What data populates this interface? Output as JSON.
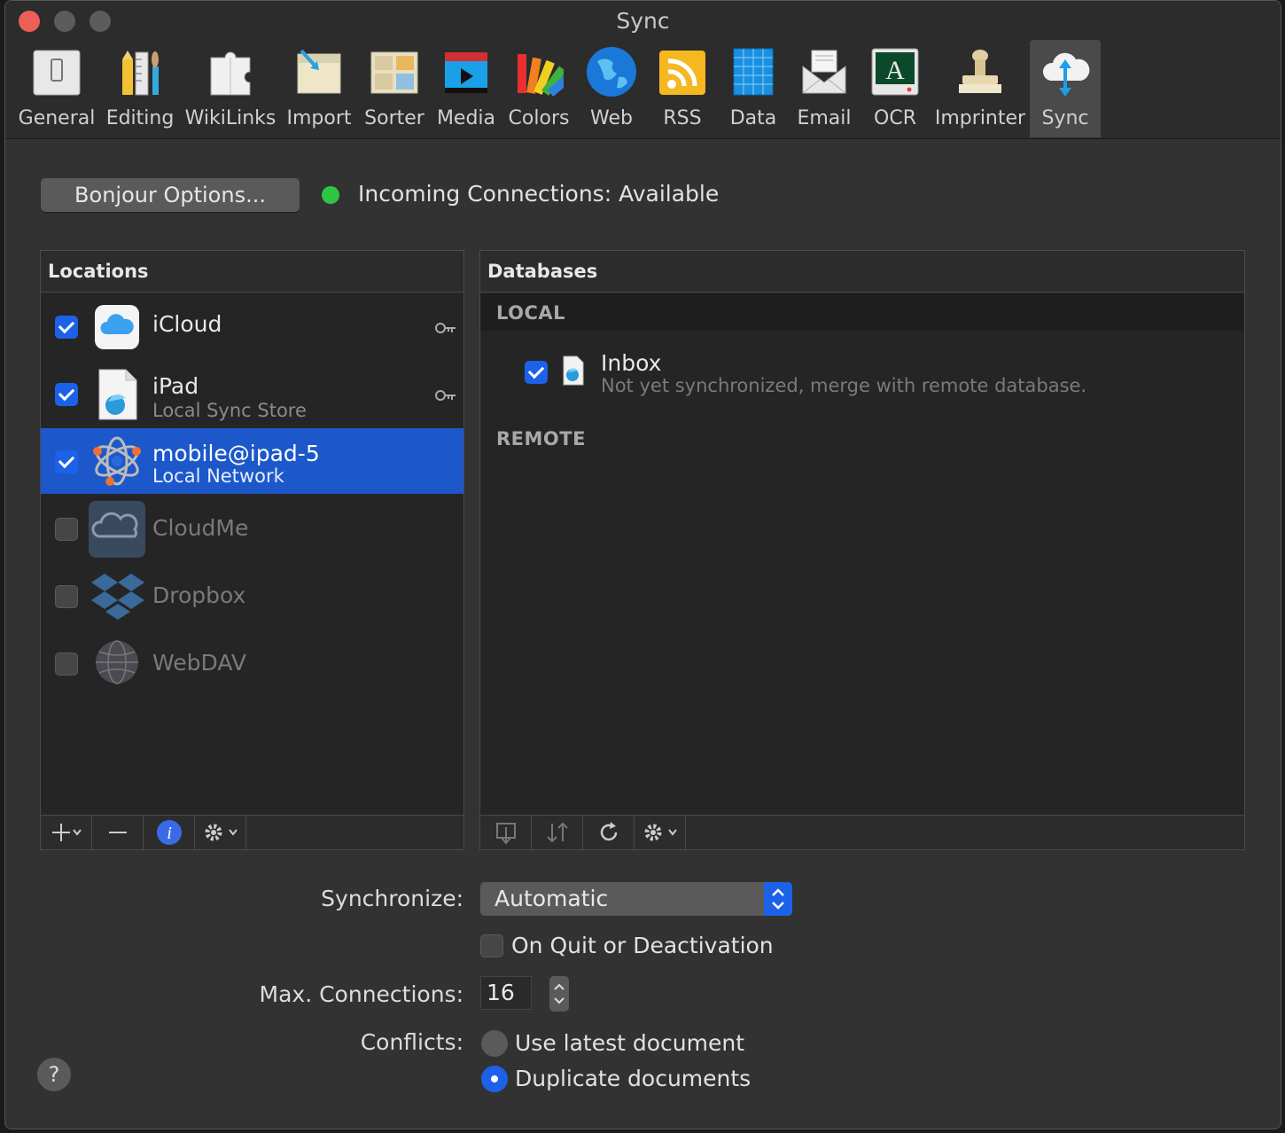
{
  "window": {
    "title": "Sync"
  },
  "toolbar": {
    "items": [
      {
        "label": "General"
      },
      {
        "label": "Editing"
      },
      {
        "label": "WikiLinks"
      },
      {
        "label": "Import"
      },
      {
        "label": "Sorter"
      },
      {
        "label": "Media"
      },
      {
        "label": "Colors"
      },
      {
        "label": "Web"
      },
      {
        "label": "RSS"
      },
      {
        "label": "Data"
      },
      {
        "label": "Email"
      },
      {
        "label": "OCR"
      },
      {
        "label": "Imprinter"
      },
      {
        "label": "Sync",
        "active": true
      }
    ]
  },
  "bonjour_button": "Bonjour Options...",
  "incoming_status": "Incoming Connections: Available",
  "locations": {
    "header": "Locations",
    "items": [
      {
        "name": "iCloud",
        "sub": "",
        "checked": true
      },
      {
        "name": "iPad",
        "sub": "Local Sync Store",
        "checked": true
      },
      {
        "name": "mobile@ipad-5",
        "sub": "Local Network",
        "checked": true,
        "selected": true
      },
      {
        "name": "CloudMe",
        "sub": "",
        "checked": false
      },
      {
        "name": "Dropbox",
        "sub": "",
        "checked": false
      },
      {
        "name": "WebDAV",
        "sub": "",
        "checked": false
      }
    ]
  },
  "databases": {
    "header": "Databases",
    "local_label": "LOCAL",
    "remote_label": "REMOTE",
    "local_items": [
      {
        "name": "Inbox",
        "sub": "Not yet synchronized, merge with remote database.",
        "checked": true
      }
    ]
  },
  "settings": {
    "synchronize_label": "Synchronize:",
    "synchronize_value": "Automatic",
    "on_quit_label": "On Quit or Deactivation",
    "max_connections_label": "Max. Connections:",
    "max_connections_value": "16",
    "conflicts_label": "Conflicts:",
    "conflict_options": [
      {
        "label": "Use latest document",
        "selected": false
      },
      {
        "label": "Duplicate documents",
        "selected": true
      }
    ]
  },
  "help_button": "?",
  "colors": {
    "accent": "#1c62e8",
    "selection": "#1c58c9",
    "status_green": "#2ec542"
  }
}
